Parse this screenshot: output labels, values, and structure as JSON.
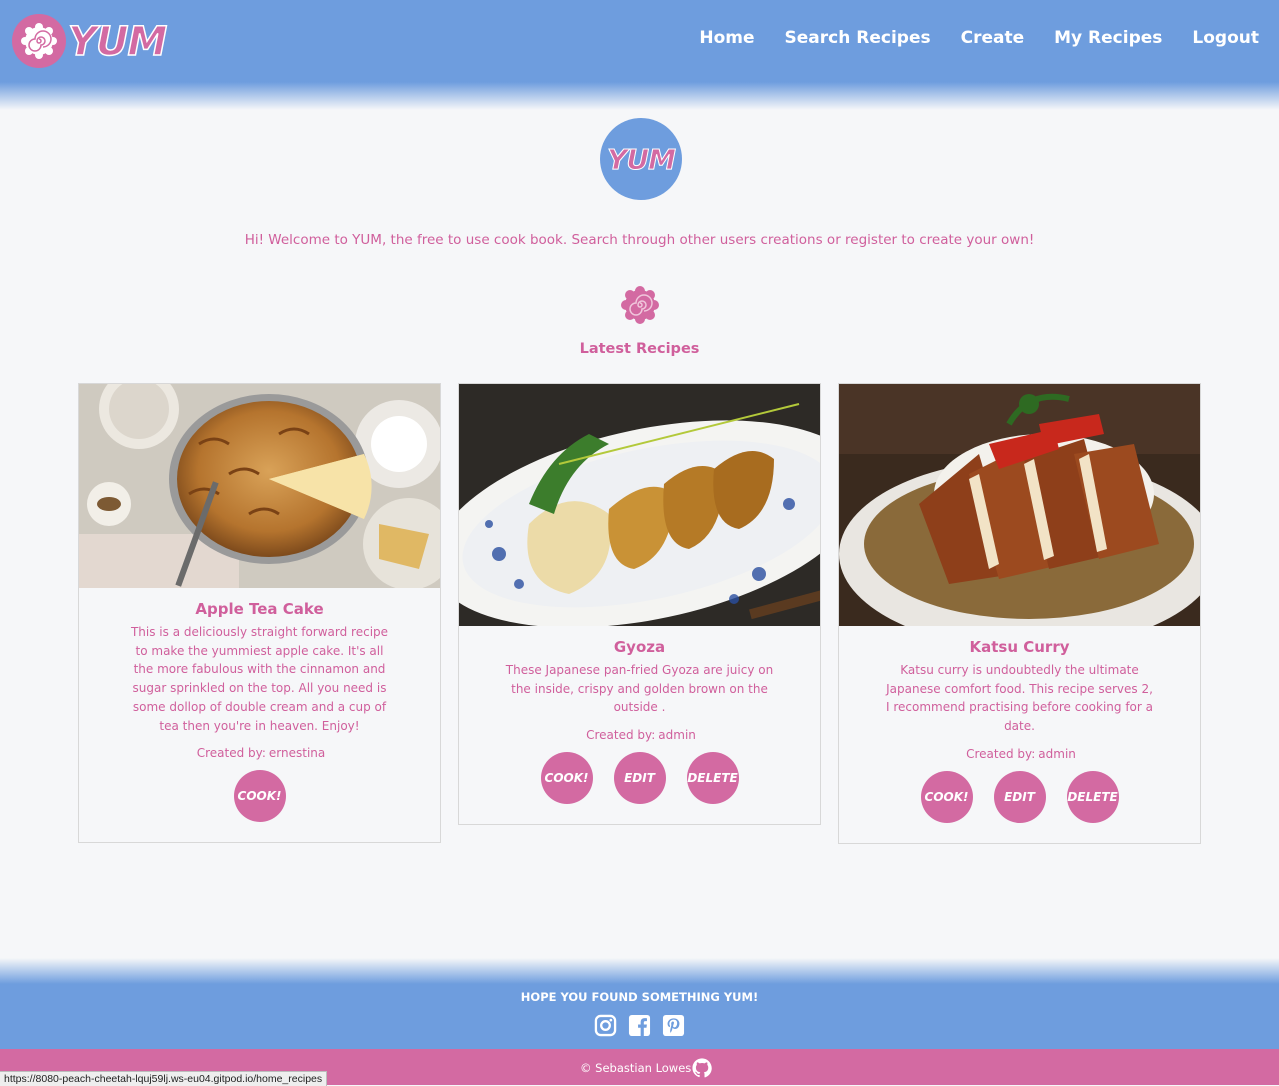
{
  "header": {
    "logo_text": "YUM",
    "nav": [
      "Home",
      "Search Recipes",
      "Create",
      "My Recipes",
      "Logout"
    ]
  },
  "hero": {
    "logo_text": "YUM",
    "welcome": "Hi! Welcome to YUM, the free to use cook book. Search through other users creations or register to create your own!",
    "section_title": "Latest Recipes"
  },
  "recipes": [
    {
      "title": "Apple Tea Cake",
      "description": "This is a deliciously straight forward recipe to make the yummiest apple cake. It's all the more fabulous with the cinnamon and sugar sprinkled on the top. All you need is some dollop of double cream and a cup of tea then you're in heaven. Enjoy!",
      "author_label": "Created by:",
      "author": "ernestina",
      "buttons": [
        "COOK!"
      ]
    },
    {
      "title": "Gyoza",
      "description": "These Japanese pan-fried Gyoza are juicy on the inside, crispy and golden brown on the outside .",
      "author_label": "Created by:",
      "author": "admin",
      "buttons": [
        "COOK!",
        "EDIT",
        "DELETE"
      ]
    },
    {
      "title": "Katsu Curry",
      "description": "Katsu curry is undoubtedly the ultimate Japanese comfort food. This recipe serves 2, I recommend practising before cooking for a date.",
      "author_label": "Created by:",
      "author": "admin",
      "buttons": [
        "COOK!",
        "EDIT",
        "DELETE"
      ]
    }
  ],
  "footer": {
    "tagline": "HOPE YOU FOUND SOMETHING YUM!",
    "social_icons": [
      "instagram-icon",
      "facebook-icon",
      "pinterest-icon"
    ],
    "copyright": "© Sebastian Lowes",
    "github_icon": "github-icon"
  },
  "status_bar": {
    "url": "https://8080-peach-cheetah-lquj59lj.ws-eu04.gitpod.io/home_recipes"
  },
  "colors": {
    "brand_blue": "#6e9dde",
    "brand_pink": "#d36aa2",
    "text_pink": "#d05f9c",
    "background": "#f6f7f9"
  }
}
